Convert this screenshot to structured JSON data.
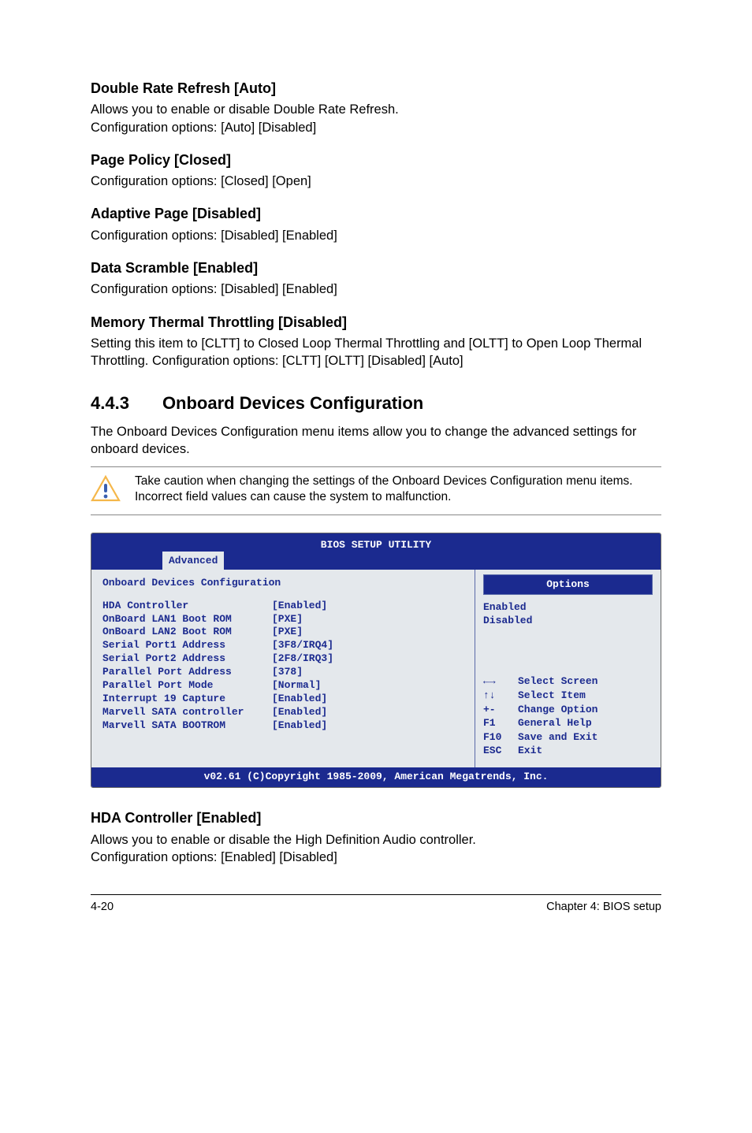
{
  "sections": {
    "s1": {
      "title": "Double Rate Refresh [Auto]",
      "p1": "Allows you to enable or disable Double Rate Refresh.",
      "p2": "Configuration options: [Auto] [Disabled]"
    },
    "s2": {
      "title": "Page Policy [Closed]",
      "p1": "Configuration options: [Closed] [Open]"
    },
    "s3": {
      "title": "Adaptive Page [Disabled]",
      "p1": "Configuration options: [Disabled] [Enabled]"
    },
    "s4": {
      "title": "Data Scramble [Enabled]",
      "p1": "Configuration options: [Disabled] [Enabled]"
    },
    "s5": {
      "title": "Memory Thermal Throttling [Disabled]",
      "p1": "Setting this item to [CLTT] to Closed Loop Thermal Throttling and [OLTT] to Open Loop Thermal Throttling. Configuration options: [CLTT] [OLTT] [Disabled] [Auto]"
    }
  },
  "h2": {
    "num": "4.4.3",
    "title": "Onboard Devices Configuration"
  },
  "h2_body": "The Onboard Devices Configuration menu items allow you to change the advanced settings for onboard devices.",
  "callout": "Take caution when changing the settings of the Onboard Devices Configuration menu items. Incorrect field values can cause the system to malfunction.",
  "bios": {
    "title": "BIOS SETUP UTILITY",
    "tab": "Advanced",
    "section_title": "Onboard Devices Configuration",
    "rows": [
      {
        "label": "HDA Controller",
        "val": "[Enabled]"
      },
      {
        "label": "OnBoard LAN1 Boot ROM",
        "val": "[PXE]"
      },
      {
        "label": "OnBoard LAN2 Boot ROM",
        "val": "[PXE]"
      },
      {
        "label": "Serial Port1 Address",
        "val": "[3F8/IRQ4]"
      },
      {
        "label": "Serial Port2 Address",
        "val": "[2F8/IRQ3]"
      },
      {
        "label": "Parallel Port Address",
        "val": "[378]"
      },
      {
        "label": "Parallel Port Mode",
        "val": "[Normal]"
      },
      {
        "label": "Interrupt 19 Capture",
        "val": "[Enabled]"
      },
      {
        "label": "Marvell SATA controller",
        "val": "[Enabled]"
      },
      {
        "label": "Marvell SATA BOOTROM",
        "val": "[Enabled]"
      }
    ],
    "options_title": "Options",
    "options": [
      "Enabled",
      "Disabled"
    ],
    "nav": [
      {
        "k": "←→",
        "t": "Select Screen"
      },
      {
        "k": "↑↓",
        "t": "Select Item"
      },
      {
        "k": "+-",
        "t": "Change Option"
      },
      {
        "k": "F1",
        "t": "General Help"
      },
      {
        "k": "F10",
        "t": "Save and Exit"
      },
      {
        "k": "ESC",
        "t": "Exit"
      }
    ],
    "footer": "v02.61 (C)Copyright 1985-2009, American Megatrends, Inc."
  },
  "post": {
    "title": "HDA Controller [Enabled]",
    "p1": "Allows you to enable or disable the High Definition Audio controller.",
    "p2": "Configuration options: [Enabled] [Disabled]"
  },
  "footer": {
    "left": "4-20",
    "right": "Chapter 4: BIOS setup"
  }
}
